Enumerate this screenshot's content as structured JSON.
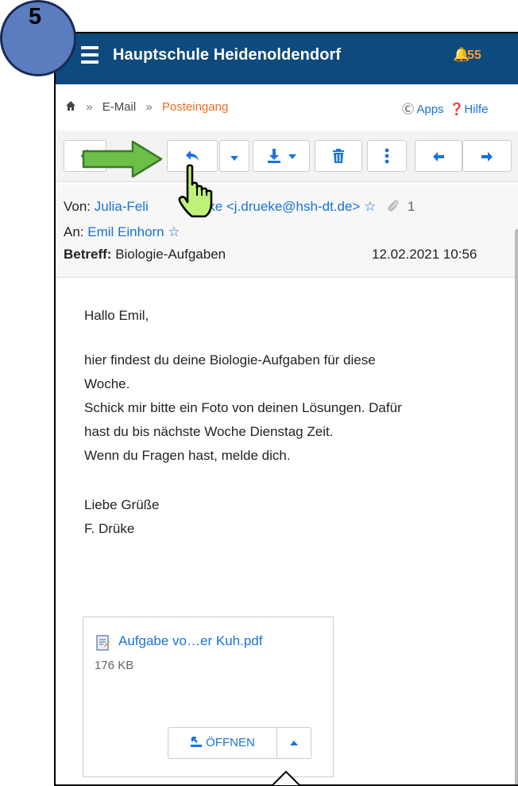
{
  "step_badge": "5",
  "header": {
    "title": "Hauptschule Heidenoldendorf",
    "notifications": "55"
  },
  "breadcrumb": {
    "items": [
      "E-Mail",
      "Posteingang"
    ],
    "separator": "»"
  },
  "links": {
    "apps": "Apps",
    "help": "Hilfe"
  },
  "icons": {
    "back": "chevron-left-icon",
    "reply": "reply-icon",
    "dropdown": "caret-down-icon",
    "download": "download-icon",
    "delete": "trash-icon",
    "more": "more-vertical-icon",
    "prev": "arrow-left-icon",
    "next": "arrow-right-icon",
    "star": "star-icon",
    "attachment": "paperclip-icon",
    "pointer": "hand-pointer-icon",
    "callout_arrow": "green-arrow-icon"
  },
  "email": {
    "from_label": "Von:",
    "from_name_part1": "Julia-Feli",
    "from_name_part2": "Drüke <j.drueke@hsh-dt.de>",
    "attachment_count": "1",
    "to_label": "An:",
    "to_name": "Emil Einhorn",
    "subject_label": "Betreff:",
    "subject": "Biologie-Aufgaben",
    "date": "12.02.2021 10:56",
    "body": [
      "Hallo Emil,",
      "hier findest du deine Biologie-Aufgaben für diese",
      "Woche.",
      "Schick mir bitte ein Foto von deinen Lösungen. Dafür",
      "hast du bis nächste Woche Dienstag Zeit.",
      "Wenn du Fragen hast, melde dich.",
      "Liebe Grüße",
      "F. Drüke"
    ]
  },
  "attachment": {
    "name": "Aufgabe vo…er Kuh.pdf",
    "size": "176 KB",
    "open_label": "ÖFFNEN"
  },
  "colors": {
    "header_bg": "#0f4a7e",
    "accent": "#1a73d9",
    "active_crumb": "#f26a1b",
    "badge": "#f0a030",
    "callout_green": "#6cc04a"
  }
}
